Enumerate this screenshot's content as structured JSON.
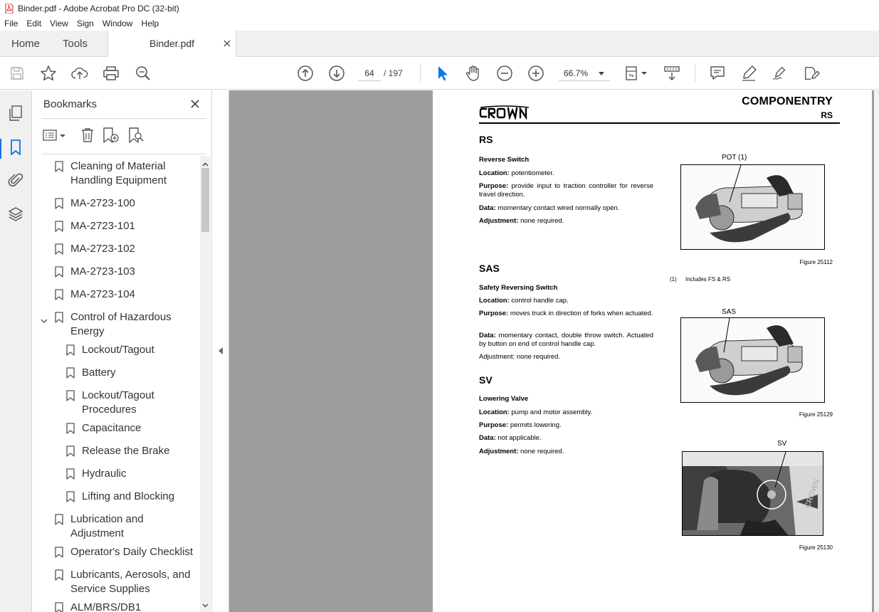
{
  "window": {
    "title": "Binder.pdf - Adobe Acrobat Pro DC (32-bit)"
  },
  "menubar": {
    "items": [
      "File",
      "Edit",
      "View",
      "Sign",
      "Window",
      "Help"
    ]
  },
  "tabs": {
    "home": "Home",
    "tools": "Tools",
    "document": "Binder.pdf"
  },
  "toolbar": {
    "current_page": "64",
    "total_pages": "/ 197",
    "zoom": "66.7%"
  },
  "bookmarks": {
    "title": "Bookmarks",
    "items": [
      {
        "label": "Cleaning of Material Handling Equipment",
        "level": 1
      },
      {
        "label": "MA-2723-100",
        "level": 1
      },
      {
        "label": "MA-2723-101",
        "level": 1
      },
      {
        "label": "MA-2723-102",
        "level": 1
      },
      {
        "label": "MA-2723-103",
        "level": 1
      },
      {
        "label": "MA-2723-104",
        "level": 1
      },
      {
        "label": "Control of Hazardous Energy",
        "level": 1,
        "expanded": true
      },
      {
        "label": "Lockout/Tagout",
        "level": 2
      },
      {
        "label": "Battery",
        "level": 2
      },
      {
        "label": "Lockout/Tagout Procedures",
        "level": 2
      },
      {
        "label": "Capacitance",
        "level": 2
      },
      {
        "label": "Release the Brake",
        "level": 2
      },
      {
        "label": "Hydraulic",
        "level": 2
      },
      {
        "label": "Lifting and Blocking",
        "level": 2
      },
      {
        "label": "Lubrication and Adjustment",
        "level": 1
      },
      {
        "label": "Operator's Daily Checklist",
        "level": 1
      },
      {
        "label": "Lubricants, Aerosols, and Service Supplies",
        "level": 1
      },
      {
        "label": "ALM/BRS/DB1",
        "level": 1
      }
    ]
  },
  "document": {
    "header_title": "COMPONENTRY",
    "header_sub": "RS",
    "sections": [
      {
        "code": "RS",
        "name": "Reverse Switch",
        "location": "potentiometer.",
        "purpose": "provide input to traction controller for reverse travel direction.",
        "data": "momentary contact wired normally open.",
        "adjustment": "none required."
      },
      {
        "code": "SAS",
        "name": "Safety Reversing Switch",
        "location": "control handle cap.",
        "purpose": "moves truck in direction of forks when actuated.",
        "data": "momentary contact, double throw switch. Actuated by button on end of control handle cap.",
        "adjustment": "none required."
      },
      {
        "code": "SV",
        "name": "Lowering Valve",
        "location": "pump and motor assembly.",
        "purpose": "permits lowering.",
        "data": "not applicable.",
        "adjustment": "none required."
      }
    ],
    "labels": {
      "location": "Location:",
      "purpose": "Purpose:",
      "data": "Data:",
      "adjustment": "Adjustment:"
    },
    "figures": [
      {
        "callout": "POT (1)",
        "caption": "Figure 25112"
      },
      {
        "callout": "SAS",
        "caption": "Figure 25129"
      },
      {
        "callout": "SV",
        "caption": "Figure 25130"
      }
    ],
    "footnote_num": "(1)",
    "footnote_text": "Includes FS & RS",
    "photo_brand": "CROWN"
  },
  "colors": {
    "accent": "#1473e6",
    "pdf_red": "#d7262e",
    "canvas_gray": "#9d9d9d"
  }
}
